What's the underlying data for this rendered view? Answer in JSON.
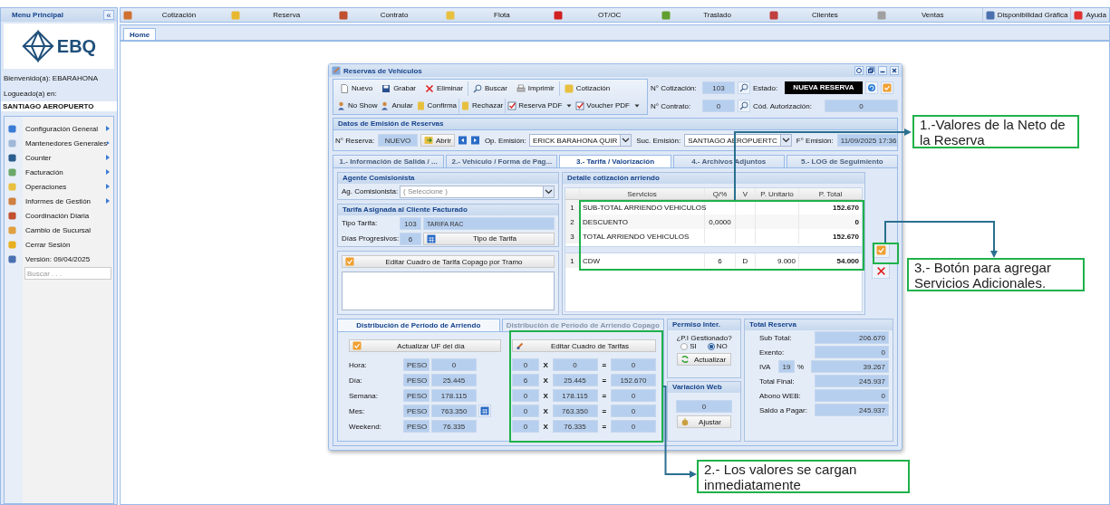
{
  "sidebar": {
    "title": "Menu Principal",
    "collapse_glyph": "«",
    "logo_text": "EBQ",
    "welcome": "Bienvenido(a): EBARAHONA",
    "logged_label": "Logueado(a) en:",
    "branch": "SANTIAGO AEROPUERTO",
    "items": [
      {
        "label": "Configuración General",
        "has_submenu": true
      },
      {
        "label": "Mantenedores Generales",
        "has_submenu": true
      },
      {
        "label": "Counter",
        "has_submenu": true
      },
      {
        "label": "Facturación",
        "has_submenu": true
      },
      {
        "label": "Operaciones",
        "has_submenu": true
      },
      {
        "label": "Informes de Gestión",
        "has_submenu": true
      },
      {
        "label": "Coordinación Diaria",
        "has_submenu": false
      },
      {
        "label": "Cambio de Sucursal",
        "has_submenu": false
      },
      {
        "label": "Cerrar Sesión",
        "has_submenu": false
      },
      {
        "label": "Versión: 09/04/2025",
        "has_submenu": false
      }
    ],
    "search_placeholder": "Buscar . . ."
  },
  "top_menu": [
    {
      "label": "Cotización",
      "kind": "wide"
    },
    {
      "label": "Reserva",
      "kind": "wide"
    },
    {
      "label": "Contrato",
      "kind": "wide"
    },
    {
      "label": "Flota",
      "kind": "wide"
    },
    {
      "label": "OT/OC",
      "kind": "wide"
    },
    {
      "label": "Traslado",
      "kind": "wide"
    },
    {
      "label": "Clientes",
      "kind": "wide"
    },
    {
      "label": "Ventas",
      "kind": "wide"
    },
    {
      "label": "Disponibilidad Gráfica",
      "kind": "compact"
    },
    {
      "label": "Ayuda",
      "kind": "compact"
    }
  ],
  "page_tabs": [
    {
      "label": "Home",
      "selected": true
    }
  ],
  "dialog": {
    "title": "Reservas de Vehículos",
    "toolbar_row1": [
      {
        "label": "Nuevo"
      },
      {
        "label": "Grabar"
      },
      {
        "label": "Eliminar"
      },
      {
        "label": "Buscar"
      },
      {
        "label": "Imprimir"
      },
      {
        "label": "Cotización"
      }
    ],
    "toolbar_row2": [
      {
        "label": "No Show",
        "dropdown": false
      },
      {
        "label": "Anular",
        "dropdown": false
      },
      {
        "label": "Confirma",
        "dropdown": false
      },
      {
        "label": "Rechazar",
        "dropdown": false
      },
      {
        "label": "Reserva PDF",
        "dropdown": true
      },
      {
        "label": "Voucher PDF",
        "dropdown": true
      }
    ],
    "quote": {
      "label": "N° Cotización:",
      "value": "103"
    },
    "status": {
      "label": "Estado:",
      "value": "NUEVA RESERVA"
    },
    "contract": {
      "label": "N° Contrato:",
      "value": "0"
    },
    "authorization": {
      "label": "Cód. Autorización:",
      "value": "0"
    },
    "emission": {
      "title": "Datos de Emisión de Reservas",
      "reserva_label": "N° Reserva:",
      "reserva_value": "NUEVO",
      "open_button": "Abrir",
      "operator_label": "Op. Emisión:",
      "operator_value": "ERICK BARAHONA QUIR",
      "branch_label": "Suc. Emisión:",
      "branch_value": "SANTIAGO AEROPUERTC",
      "date_label": "F° Emisión:",
      "date_value": "11/09/2025 17:36"
    },
    "tabs": [
      {
        "label": "1.- Información de Salida / ...",
        "selected": false
      },
      {
        "label": "2.- Vehículo / Forma de Pag...",
        "selected": false
      },
      {
        "label": "3.- Tarifa / Valorización",
        "selected": true
      },
      {
        "label": "4.- Archivos Adjuntos",
        "selected": false
      },
      {
        "label": "5.- LOG de Seguimiento",
        "selected": false
      }
    ],
    "agent": {
      "title": "Agente Comisionista",
      "label": "Ag. Comisionista:",
      "placeholder": "( Seleccione )"
    },
    "tariff": {
      "title": "Tarifa Asignada al Cliente Facturado",
      "type_label": "Tipo Tarifa:",
      "type_code": "103",
      "type_name": "TARIFA RAC",
      "days_label": "Días Progresivos:",
      "days_value": "6",
      "type_button": "Tipo de Tarifa",
      "copago_button": "Editar Cuadro de Tarifa Copago por Tramo"
    },
    "detail": {
      "title": "Detalle cotización arriendo",
      "columns": [
        "Servicios",
        "Q/%",
        "V",
        "P. Unitario",
        "P. Total"
      ],
      "rows": [
        {
          "number": "1",
          "cells": [
            "SUB-TOTAL ARRIENDO VEHICULOS",
            "",
            "",
            "",
            "152.670"
          ]
        },
        {
          "number": "2",
          "cells": [
            "DESCUENTO",
            "0,0000",
            "",
            "",
            "0"
          ]
        },
        {
          "number": "3",
          "cells": [
            "TOTAL ARRIENDO VEHICULOS",
            "",
            "",
            "",
            "152.670"
          ]
        }
      ],
      "extra_rows": [
        {
          "number": "1",
          "cells": [
            "CDW",
            "6",
            "D",
            "9.000",
            "54.000"
          ]
        }
      ]
    },
    "distribution": {
      "tabs": [
        {
          "label": "Distribución de Período de Arriendo",
          "selected": true,
          "disabled": false
        },
        {
          "label": "Distribución de Período de Arriendo Copago",
          "selected": false,
          "disabled": true
        }
      ],
      "uf_button": "Actualizar UF del día",
      "edit_button": "Editar Cuadro de Tarifas",
      "rows": [
        {
          "label": "Hora:",
          "currency": "PESO",
          "rate": "0",
          "calendar": false,
          "qty": "0",
          "times": "X",
          "price": "0",
          "equals": "=",
          "total": "0"
        },
        {
          "label": "Día:",
          "currency": "PESO",
          "rate": "25.445",
          "calendar": false,
          "qty": "6",
          "times": "X",
          "price": "25.445",
          "equals": "=",
          "total": "152.670"
        },
        {
          "label": "Semana:",
          "currency": "PESO",
          "rate": "178.115",
          "calendar": false,
          "qty": "0",
          "times": "X",
          "price": "178.115",
          "equals": "=",
          "total": "0"
        },
        {
          "label": "Mes:",
          "currency": "PESO",
          "rate": "763.350",
          "calendar": true,
          "qty": "0",
          "times": "X",
          "price": "763.350",
          "equals": "=",
          "total": "0"
        },
        {
          "label": "Weekend:",
          "currency": "PESO",
          "rate": "76.335",
          "calendar": false,
          "qty": "0",
          "times": "X",
          "price": "76.335",
          "equals": "=",
          "total": "0"
        }
      ]
    },
    "permit": {
      "title": "Permiso Inter.",
      "question": "¿P.I Gestionado?",
      "options": [
        {
          "label": "SI",
          "selected": false
        },
        {
          "label": "NO",
          "selected": true
        }
      ],
      "button": "Actualizar"
    },
    "web": {
      "title": "Variación Web",
      "value": "0",
      "button": "Ajustar"
    },
    "totals": {
      "title": "Total Reserva",
      "rows": [
        {
          "kind": "plain",
          "label": "Sub Total:",
          "value": "206.670"
        },
        {
          "kind": "plain",
          "label": "Exento:",
          "value": "0"
        },
        {
          "kind": "tax",
          "label": "IVA",
          "rate": "19",
          "unit": "%",
          "value": "39.267"
        },
        {
          "kind": "plain",
          "label": "Total Final:",
          "value": "245.937"
        },
        {
          "kind": "plain",
          "label": "Abono WEB:",
          "value": "0"
        },
        {
          "kind": "plain",
          "label": "Saldo a Pagar:",
          "value": "245.937"
        }
      ]
    }
  },
  "annotations": [
    {
      "text": "1.-Valores de la Neto de la Reserva"
    },
    {
      "text": "3.- Botón para agregar Servicios Adicionales."
    },
    {
      "text": "2.- Los valores se cargan inmediatamente"
    }
  ]
}
